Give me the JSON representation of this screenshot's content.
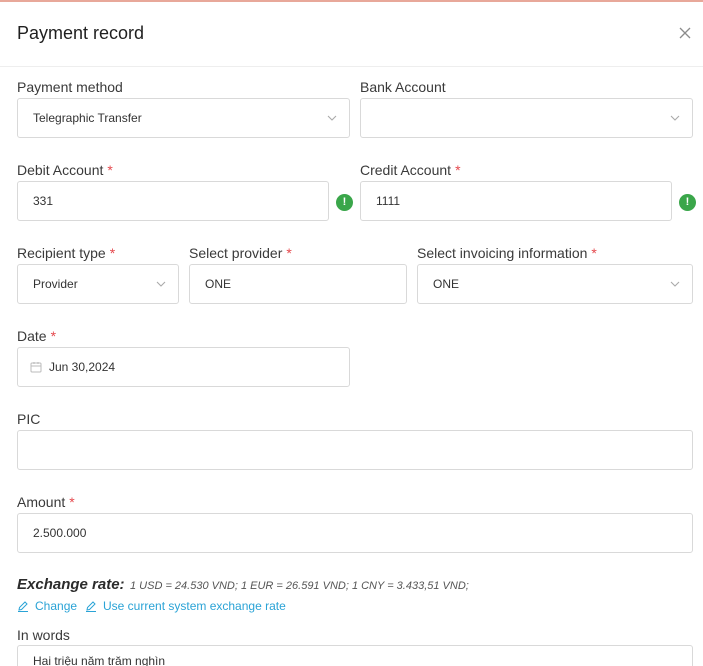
{
  "dialog": {
    "title": "Payment record"
  },
  "payment_method": {
    "label": "Payment method",
    "value": "Telegraphic Transfer"
  },
  "bank_account": {
    "label": "Bank Account",
    "value": ""
  },
  "debit_account": {
    "label": "Debit Account",
    "required": "*",
    "value": "331"
  },
  "credit_account": {
    "label": "Credit Account",
    "required": "*",
    "value": "1111"
  },
  "recipient_type": {
    "label": "Recipient type",
    "required": "*",
    "value": "Provider"
  },
  "provider": {
    "label": "Select provider",
    "required": "*",
    "value": "ONE"
  },
  "invoicing": {
    "label": "Select invoicing information",
    "required": "*",
    "value": "ONE"
  },
  "date": {
    "label": "Date",
    "required": "*",
    "value": "Jun 30,2024"
  },
  "pic": {
    "label": "PIC",
    "value": ""
  },
  "amount": {
    "label": "Amount",
    "required": "*",
    "value": "2.500.000"
  },
  "exchange": {
    "title": "Exchange rate:",
    "rates": "1 USD = 24.530 VND; 1 EUR = 26.591 VND; 1 CNY = 3.433,51 VND;",
    "change_label": "Change",
    "use_current_label": "Use current system exchange rate"
  },
  "in_words": {
    "label": "In words",
    "value": "Hai triệu năm trăm nghìn"
  },
  "colors": {
    "accent": "#2aa3d6",
    "required": "#e5484d",
    "warning": "#3aa64a"
  }
}
